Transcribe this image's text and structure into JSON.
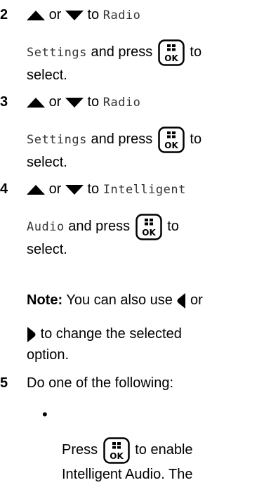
{
  "steps": [
    {
      "number": "2",
      "or": "or",
      "to": "to",
      "menu_item_a": "Radio",
      "menu_item_b": "Settings",
      "press": "and press",
      "to2": "to",
      "select": "select."
    },
    {
      "number": "3",
      "or": "or",
      "to": "to",
      "menu_item_a": "Radio",
      "menu_item_b": "Settings",
      "press": "and press",
      "to2": "to",
      "select": "select."
    },
    {
      "number": "4",
      "or": "or",
      "to": "to",
      "menu_item_a": "Intelligent",
      "menu_item_b": "Audio",
      "press": "and press",
      "to2": "to",
      "select": "select."
    }
  ],
  "note": {
    "label": "Note:",
    "text_a": "You can also use",
    "or": "or",
    "text_b": "to change the selected",
    "text_c": "option."
  },
  "step5": {
    "number": "5",
    "text": "Do one of the following:",
    "bullet": "•",
    "press": "Press",
    "enable_text": "to enable",
    "cont_text": "Intelligent Audio. The"
  },
  "ok_key_label": "OK"
}
